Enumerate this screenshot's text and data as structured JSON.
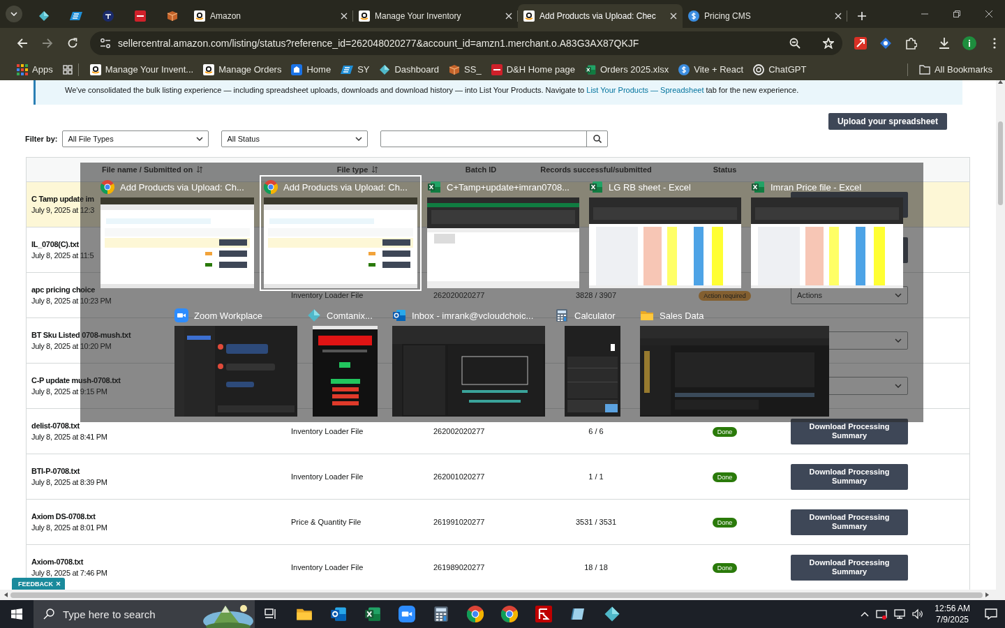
{
  "tabs": [
    {
      "kind": "pinned",
      "selected": false
    },
    {
      "kind": "pinned",
      "selected": false
    },
    {
      "kind": "pinned",
      "selected": false
    },
    {
      "kind": "pinned",
      "selected": false
    },
    {
      "kind": "pinned",
      "selected": false
    },
    {
      "kind": "page",
      "label": "Amazon",
      "selected": false
    },
    {
      "kind": "page",
      "label": "Manage Your Inventory",
      "selected": false
    },
    {
      "kind": "page",
      "label": "Add Products via Upload: Chec",
      "selected": true
    },
    {
      "kind": "page",
      "label": "Pricing CMS",
      "selected": false
    }
  ],
  "address_bar": {
    "value": "sellercentral.amazon.com/listing/status?reference_id=262048020277&account_id=amzn1.merchant.o.A83G3AX87QKJF"
  },
  "bookmarks": [
    {
      "label": "Apps"
    },
    {
      "label": "Manage Your Invent..."
    },
    {
      "label": "Manage Orders"
    },
    {
      "label": "Home"
    },
    {
      "label": "SY"
    },
    {
      "label": "Dashboard"
    },
    {
      "label": "SS_"
    },
    {
      "label": "D&H Home page"
    },
    {
      "label": "Orders 2025.xlsx"
    },
    {
      "label": "Vite + React"
    },
    {
      "label": "ChatGPT"
    }
  ],
  "all_bookmarks": "All Bookmarks",
  "notice": {
    "text": "We've consolidated the bulk listing experience — including spreadsheet uploads, downloads and download history — into List Your Products. Navigate to ",
    "link": "List Your Products — Spreadsheet",
    "text_after": " tab for the new experience."
  },
  "upload_button": "Upload your spreadsheet",
  "filter": {
    "label": "Filter by:",
    "file_type": "All File Types",
    "status": "All Status"
  },
  "table": {
    "columns": [
      {
        "label": "File name / Submitted on",
        "sortable": true
      },
      {
        "label": "File type",
        "sortable": true
      },
      {
        "label": "Batch ID",
        "sortable": false
      },
      {
        "label": "Records successful/submitted",
        "sortable": false
      },
      {
        "label": "Status",
        "sortable": false
      }
    ],
    "rows": [
      {
        "name": "C Tamp update im",
        "submitted": "July 9, 2025 at 12:3",
        "selected": true,
        "action": {
          "kind": "button"
        }
      },
      {
        "name": "IL_0708(C).txt",
        "submitted": "July 8, 2025 at 11:5",
        "selected": false,
        "action": {
          "kind": "button"
        }
      },
      {
        "name": "apc pricing choice",
        "submitted": "July 8, 2025 at 10:23 PM",
        "file_type": "Inventory Loader File",
        "batch_id": "262020020277",
        "records": "3828 / 3907",
        "status": {
          "label": "Action required",
          "kind": "warning"
        },
        "selected": false,
        "action": {
          "kind": "dropdown",
          "label": "Actions"
        }
      },
      {
        "name": "BT Sku Listed 0708-mush.txt",
        "submitted": "July 8, 2025 at 10:20 PM",
        "selected": false,
        "action": {
          "kind": "dropdown"
        }
      },
      {
        "name": "C-P update mush-0708.txt",
        "submitted": "July 8, 2025 at 9:15 PM",
        "selected": false,
        "action": {
          "kind": "dropdown"
        }
      },
      {
        "name": "delist-0708.txt",
        "submitted": "July 8, 2025 at 8:41 PM",
        "file_type": "Inventory Loader File",
        "batch_id": "262002020277",
        "records": "6 / 6",
        "status": {
          "label": "Done",
          "kind": "done"
        },
        "selected": false,
        "action": {
          "kind": "button",
          "label": "Download Processing Summary"
        }
      },
      {
        "name": "BTI-P-0708.txt",
        "submitted": "July 8, 2025 at 8:39 PM",
        "file_type": "Inventory Loader File",
        "batch_id": "262001020277",
        "records": "1 / 1",
        "status": {
          "label": "Done",
          "kind": "done"
        },
        "selected": false,
        "action": {
          "kind": "button",
          "label": "Download Processing Summary"
        }
      },
      {
        "name": "Axiom DS-0708.txt",
        "submitted": "July 8, 2025 at 8:01 PM",
        "file_type": "Price & Quantity File",
        "batch_id": "261991020277",
        "records": "3531 / 3531",
        "status": {
          "label": "Done",
          "kind": "done"
        },
        "selected": false,
        "action": {
          "kind": "button",
          "label": "Download Processing Summary"
        }
      },
      {
        "name": "Axiom-0708.txt",
        "submitted": "July 8, 2025 at 7:46 PM",
        "file_type": "Inventory Loader File",
        "batch_id": "261989020277",
        "records": "18 / 18",
        "status": {
          "label": "Done",
          "kind": "done"
        },
        "selected": false,
        "action": {
          "kind": "button",
          "label": "Download Processing Summary"
        }
      }
    ]
  },
  "feedback": "FEEDBACK",
  "task_switcher": {
    "rows": [
      {
        "windows": [
          {
            "title": "Add Products via Upload: Ch...",
            "kind": "browser",
            "selected": false
          },
          {
            "title": "Add Products via Upload: Ch...",
            "kind": "browser",
            "selected": true
          },
          {
            "title": "C+Tamp+update+imran0708...",
            "kind": "spreadsheet-blank",
            "selected": false
          },
          {
            "title": "LG RB sheet - Excel",
            "kind": "spreadsheet",
            "selected": false
          },
          {
            "title": "Imran Price file - Excel",
            "kind": "spreadsheet",
            "selected": false
          }
        ]
      },
      {
        "windows": [
          {
            "title": "Zoom Workplace",
            "kind": "chat",
            "selected": false
          },
          {
            "title": "Comtanix...",
            "kind": "dialog",
            "selected": false
          },
          {
            "title": "Inbox - imrank@vcloudchoic...",
            "kind": "mail",
            "selected": false
          },
          {
            "title": "Calculator",
            "kind": "calculator",
            "selected": false
          },
          {
            "title": "Sales Data",
            "kind": "explorer",
            "selected": false
          }
        ]
      }
    ]
  },
  "taskbar": {
    "placeholder": "Type here to search",
    "time": "12:56 AM",
    "date": "7/9/2025"
  }
}
